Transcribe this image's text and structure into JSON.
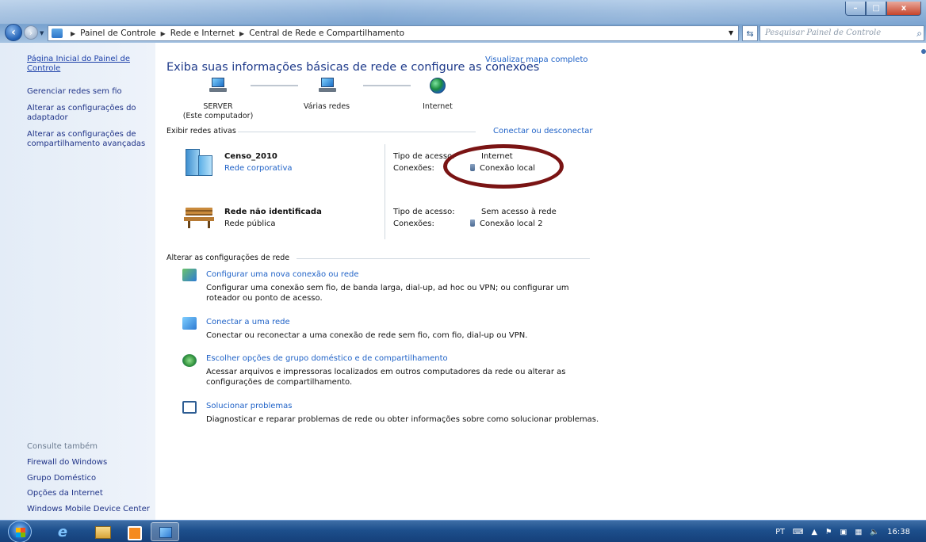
{
  "window": {
    "buttons": {
      "minimize": "–",
      "maximize": "□",
      "close": "x"
    }
  },
  "address_bar": {
    "breadcrumbs": [
      "Painel de Controle",
      "Rede e Internet",
      "Central de Rede e Compartilhamento"
    ],
    "search_placeholder": "Pesquisar Painel de Controle"
  },
  "sidebar": {
    "home_link": "Página Inicial do Painel de Controle",
    "tasks": [
      "Gerenciar redes sem fio",
      "Alterar as configurações do adaptador",
      "Alterar as configurações de compartilhamento avançadas"
    ],
    "see_also_title": "Consulte também",
    "see_also": [
      "Firewall do Windows",
      "Grupo Doméstico",
      "Opções da Internet",
      "Windows Mobile Device Center"
    ]
  },
  "main": {
    "heading": "Exiba suas informações básicas de rede e configure as conexões",
    "map_link": "Visualizar mapa completo",
    "map_nodes": {
      "computer": "SERVER",
      "computer_sub": "(Este computador)",
      "networks": "Várias redes",
      "internet": "Internet"
    },
    "active_networks_title": "Exibir redes ativas",
    "connect_link": "Conectar ou desconectar",
    "networks": [
      {
        "name": "Censo_2010",
        "category": "Rede corporativa",
        "access_label": "Tipo de acesso:",
        "access_value": "Internet",
        "connections_label": "Conexões:",
        "connection": "Conexão local"
      },
      {
        "name": "Rede não identificada",
        "category": "Rede pública",
        "access_label": "Tipo de acesso:",
        "access_value": "Sem acesso à rede",
        "connections_label": "Conexões:",
        "connection": "Conexão local 2"
      }
    ],
    "change_settings_title": "Alterar as configurações de rede",
    "tasks": [
      {
        "title": "Configurar uma nova conexão ou rede",
        "desc_line1": "Configurar uma conexão sem fio, de banda larga, dial-up, ad hoc ou VPN; ou configurar um",
        "desc_line2": "roteador ou ponto de acesso."
      },
      {
        "title": "Conectar a uma rede",
        "desc_line1": "Conectar ou reconectar a uma conexão de rede sem fio, com fio, dial-up ou VPN.",
        "desc_line2": ""
      },
      {
        "title": "Escolher opções de grupo doméstico e de compartilhamento",
        "desc_line1": "Acessar arquivos e impressoras localizados em outros computadores da rede ou alterar as",
        "desc_line2": "configurações de compartilhamento."
      },
      {
        "title": "Solucionar problemas",
        "desc_line1": "Diagnosticar e reparar problemas de rede ou obter informações sobre como solucionar problemas.",
        "desc_line2": ""
      }
    ]
  },
  "taskbar": {
    "language": "PT",
    "clock": "16:38"
  },
  "colors": {
    "link": "#1f62c7",
    "heading": "#1e3a8a",
    "highlight_ring": "#7a1414"
  }
}
